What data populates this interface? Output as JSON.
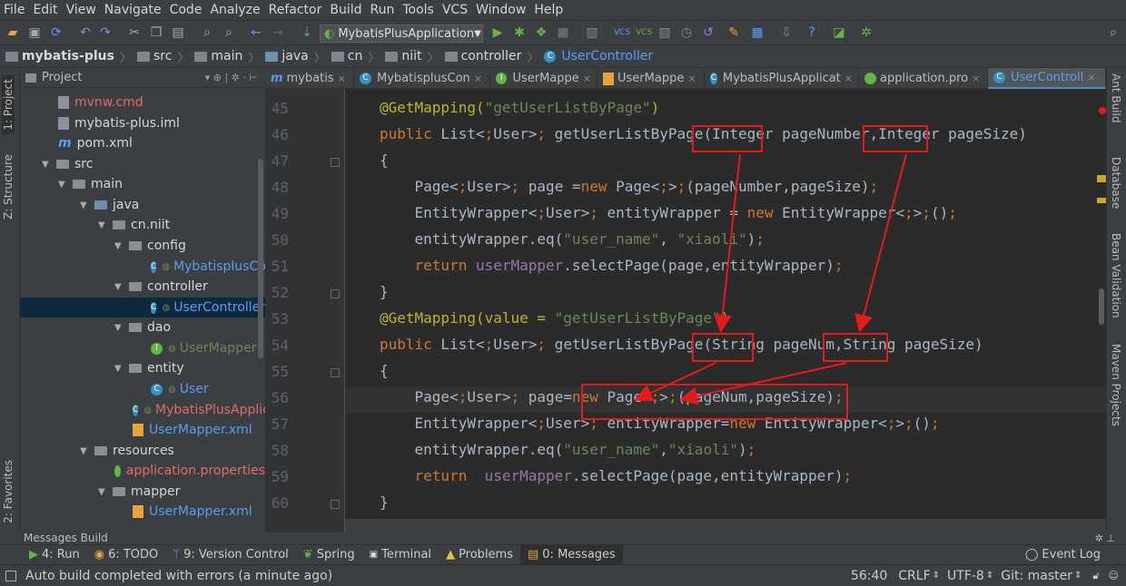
{
  "menu": [
    "File",
    "Edit",
    "View",
    "Navigate",
    "Code",
    "Analyze",
    "Refactor",
    "Build",
    "Run",
    "Tools",
    "VCS",
    "Window",
    "Help"
  ],
  "toolbar": {
    "run_config": "MybatisPlusApplication"
  },
  "breadcrumb": [
    "mybatis-plus",
    "src",
    "main",
    "java",
    "cn",
    "niit",
    "controller",
    "UserController"
  ],
  "left_tool_tabs": {
    "project": "1: Project",
    "structure": "Z: Structure",
    "favorites": "2: Favorites"
  },
  "project_panel": {
    "title": "Project",
    "tree": [
      {
        "label": "mvnw.cmd",
        "icon": "file"
      },
      {
        "label": "mybatis-plus.iml",
        "icon": "file"
      },
      {
        "label": "pom.xml",
        "icon": "maven"
      },
      {
        "label": "src",
        "icon": "folder"
      },
      {
        "label": "main",
        "icon": "folder"
      },
      {
        "label": "java",
        "icon": "folder"
      },
      {
        "label": "cn.niit",
        "icon": "package"
      },
      {
        "label": "config",
        "icon": "package"
      },
      {
        "label": "MybatisplusCo",
        "icon": "class"
      },
      {
        "label": "controller",
        "icon": "package"
      },
      {
        "label": "UserController",
        "icon": "class"
      },
      {
        "label": "dao",
        "icon": "package"
      },
      {
        "label": "UserMapper",
        "icon": "interface"
      },
      {
        "label": "entity",
        "icon": "package"
      },
      {
        "label": "User",
        "icon": "class"
      },
      {
        "label": "MybatisPlusApplic",
        "icon": "class"
      },
      {
        "label": "UserMapper.xml",
        "icon": "xml"
      },
      {
        "label": "resources",
        "icon": "folder"
      },
      {
        "label": "application.properties",
        "icon": "properties"
      },
      {
        "label": "mapper",
        "icon": "folder"
      },
      {
        "label": "UserMapper.xml",
        "icon": "xml"
      }
    ]
  },
  "editor_tabs": [
    {
      "label": "mybatis",
      "active": false
    },
    {
      "label": "MybatisplusCon",
      "active": false
    },
    {
      "label": "UserMappe",
      "active": false
    },
    {
      "label": "UserMappe",
      "active": false
    },
    {
      "label": "MybatisPlusApplicat",
      "active": false
    },
    {
      "label": "application.pro",
      "active": false
    },
    {
      "label": "UserControll",
      "active": true
    }
  ],
  "code_lines": [
    {
      "n": "45",
      "text": "@GetMapping(\"getUserListByPage\")"
    },
    {
      "n": "46",
      "text": "public List<User> getUserListByPage(Integer pageNumber,Integer pageSize)"
    },
    {
      "n": "47",
      "text": "{"
    },
    {
      "n": "48",
      "text": "    Page<User> page =new Page<>(pageNumber,pageSize);"
    },
    {
      "n": "49",
      "text": "    EntityWrapper<User> entityWrapper = new EntityWrapper<>();"
    },
    {
      "n": "50",
      "text": "    entityWrapper.eq(\"user_name\", \"xiaoli\");"
    },
    {
      "n": "51",
      "text": "    return userMapper.selectPage(page,entityWrapper);"
    },
    {
      "n": "52",
      "text": "}"
    },
    {
      "n": "53",
      "text": "@GetMapping(value = \"getUserListByPage\")"
    },
    {
      "n": "54",
      "text": "public List<User> getUserListByPage(String pageNum,String pageSize)"
    },
    {
      "n": "55",
      "text": "{"
    },
    {
      "n": "56",
      "text": "    Page<User> page=new Page<>(pageNum,pageSize);"
    },
    {
      "n": "57",
      "text": "    EntityWrapper<User> entityWrapper=new EntityWrapper<>();"
    },
    {
      "n": "58",
      "text": "    entityWrapper.eq(\"user_name\",\"xiaoli\");"
    },
    {
      "n": "59",
      "text": "    return  userMapper.selectPage(page,entityWrapper);"
    },
    {
      "n": "60",
      "text": "}"
    }
  ],
  "right_tool_tabs": [
    "Ant Build",
    "Database",
    "Bean Validation",
    "Maven Projects"
  ],
  "messages_panel": {
    "title": "Messages Build"
  },
  "bottom_tabs": [
    "4: Run",
    "6: TODO",
    "9: Version Control",
    "Spring",
    "Terminal",
    "Problems",
    "0: Messages"
  ],
  "event_log": "Event Log",
  "status": {
    "message": "Auto build completed with errors (a minute ago)",
    "position": "56:40",
    "line_sep": "CRLF",
    "encoding": "UTF-8",
    "git": "Git: master"
  }
}
